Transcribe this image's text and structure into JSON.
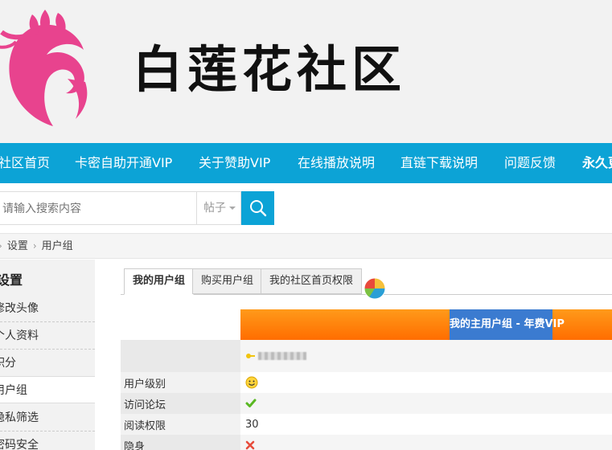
{
  "site": {
    "title": "白莲花社区",
    "colors": {
      "nav": "#0ca3d6",
      "banner": "#ff7a00",
      "banner_label": "#3b7bd0",
      "logo": "#e8438e"
    }
  },
  "nav": {
    "items": [
      {
        "label": "社区首页"
      },
      {
        "label": "卡密自助开通VIP"
      },
      {
        "label": "关于赞助VIP"
      },
      {
        "label": "在线播放说明"
      },
      {
        "label": "直链下载说明"
      },
      {
        "label": "问题反馈"
      },
      {
        "label": "永久更"
      }
    ]
  },
  "search": {
    "placeholder": "请输入搜索内容",
    "type": "帖子",
    "button_icon": "search-icon"
  },
  "breadcrumb": {
    "items": [
      "设置",
      "用户组"
    ]
  },
  "sidebar": {
    "title": "设置",
    "items": [
      {
        "label": "修改头像"
      },
      {
        "label": "个人资料"
      },
      {
        "label": "积分"
      },
      {
        "label": "用户组"
      },
      {
        "label": "隐私筛选"
      },
      {
        "label": "密码安全"
      }
    ]
  },
  "tabs": [
    {
      "label": "我的用户组"
    },
    {
      "label": "购买用户组"
    },
    {
      "label": "我的社区首页权限"
    }
  ],
  "group": {
    "banner_label": "我的主用户组 - 年费VIP"
  },
  "table": {
    "rows": [
      {
        "label": "用户级别",
        "icon": "smiley-icon"
      },
      {
        "label": "访问论坛",
        "icon": "check-icon"
      },
      {
        "label": "阅读权限",
        "value": "30"
      },
      {
        "label": "隐身",
        "icon": "cross-icon"
      }
    ]
  }
}
